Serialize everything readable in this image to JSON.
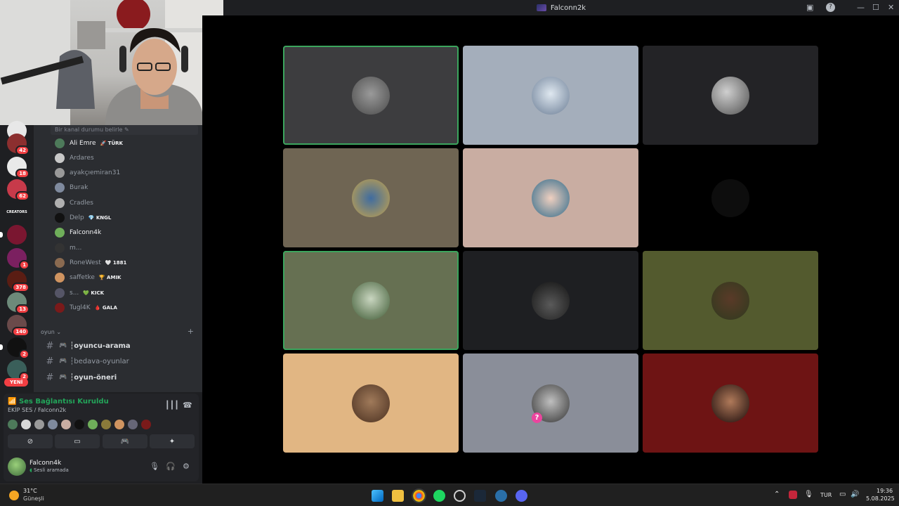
{
  "window": {
    "title": "Falconn2k"
  },
  "channel_panel": {
    "status_prompt": "Bir kanal durumu belirle",
    "members": [
      {
        "name": "Ali Emre",
        "tag": "🚀 TÜRK",
        "online": true
      },
      {
        "name": "Ardares",
        "tag": "",
        "online": false
      },
      {
        "name": "ayakçıemiran31",
        "tag": "",
        "online": false
      },
      {
        "name": "Burak",
        "tag": "",
        "online": false
      },
      {
        "name": "Cradles",
        "tag": "",
        "online": false
      },
      {
        "name": "Delp",
        "tag": "💎 KNGL",
        "online": false
      },
      {
        "name": "Falconn4k",
        "tag": "",
        "online": true
      },
      {
        "name": "m...",
        "tag": "",
        "online": false
      },
      {
        "name": "RoneWest",
        "tag": "🤍 1881",
        "online": false
      },
      {
        "name": "saffetke",
        "tag": "🏆 AMIK",
        "online": false
      },
      {
        "name": "s...",
        "tag": "💚 KICK",
        "online": false
      },
      {
        "name": "Tugl4K",
        "tag": "🩸 GALA",
        "online": false
      }
    ],
    "category": "oyun",
    "channels": [
      {
        "name": "┆oyuncu-arama"
      },
      {
        "name": "┆bedava-oyunlar"
      },
      {
        "name": "┆oyun-öneri"
      }
    ]
  },
  "servers": {
    "badges": [
      "42",
      "18",
      "62",
      "1",
      "378",
      "13",
      "140",
      "2",
      "2"
    ],
    "creators_label": "CREATORS",
    "new_label": "YENİ"
  },
  "voice": {
    "status": "Ses Bağlantısı Kuruldu",
    "channel": "EKİP SES / Falconn2k",
    "user_name": "Falconn4k",
    "user_status": "Sesli aramada"
  },
  "taskbar": {
    "temperature": "31°C",
    "weather": "Güneşli",
    "language": "TUR",
    "time": "19:36",
    "date": "5.08.2025"
  },
  "colors": {
    "speaking_outline": "#3ba55d",
    "mention_badge": "#f23f43",
    "connected_green": "#23a55a",
    "tiles": [
      "#3d3d3f",
      "#a4aebb",
      "#232326",
      "#6f6553",
      "#c9ada2",
      "#000000",
      "#667052",
      "#1e1f22",
      "#535a2e",
      "#e1b683",
      "#8a8e99",
      "#6e1414"
    ]
  }
}
